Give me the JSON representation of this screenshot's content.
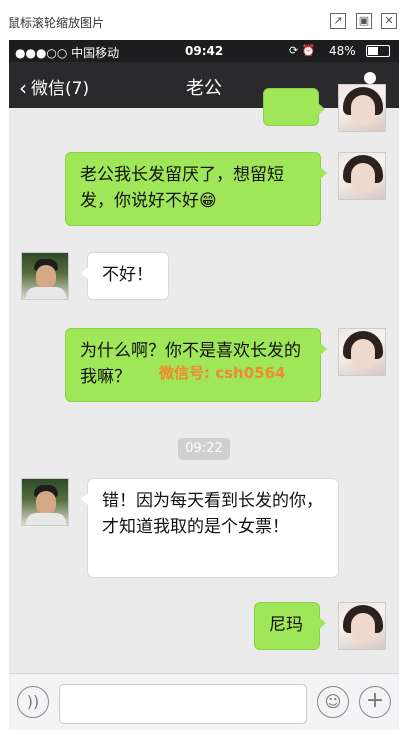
{
  "viewer": {
    "title": "鼠标滚轮缩放图片",
    "buttons": [
      "export-icon",
      "maximize-icon",
      "close-icon"
    ]
  },
  "statusbar": {
    "carrier": "●●●○○ 中国移动",
    "time": "09:42",
    "battery_pct": "48%"
  },
  "navbar": {
    "back_label": "微信(7)",
    "title": "老公"
  },
  "messages": [
    {
      "sender": "me",
      "text": "老公我长发留厌了，想留短发，你说好不好😁"
    },
    {
      "sender": "him",
      "text": "不好！"
    },
    {
      "sender": "me",
      "text": "为什么啊？你不是喜欢长发的我嘛？"
    },
    {
      "sender": "him",
      "text": "错！因为每天看到长发的你，才知道我取的是个女票！"
    },
    {
      "sender": "me",
      "text": "尼玛"
    }
  ],
  "timestamp": "09:22",
  "watermark": {
    "text": "微信号: csh0564"
  },
  "colors": {
    "sent_bubble": "#9fe658",
    "received_bubble": "#ffffff",
    "navbar": "#2a2a2d",
    "chat_bg": "#ebebeb"
  }
}
